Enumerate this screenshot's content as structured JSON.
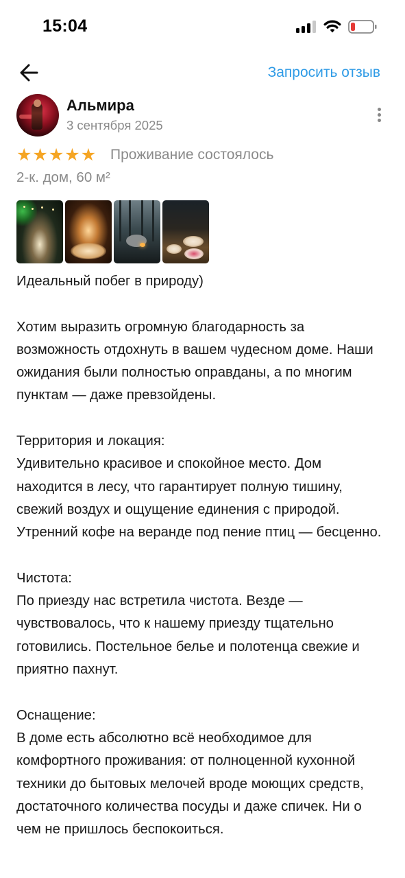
{
  "status_bar": {
    "time": "15:04",
    "icons": [
      "signal-icon",
      "wifi-icon",
      "battery-low-icon"
    ],
    "battery_color": "#e53935"
  },
  "topbar": {
    "back_icon": "arrow-left-icon",
    "request_review_label": "Запросить отзыв",
    "accent_color": "#2f9be6"
  },
  "review_header": {
    "author": "Альмира",
    "date": "3 сентября 2025",
    "more_icon": "more-vertical-icon"
  },
  "rating": {
    "stars": 5,
    "max": 5,
    "star_color": "#f5a524",
    "status": "Проживание состоялось"
  },
  "property": "2-к. дом, 60 м²",
  "photos": [
    {
      "name": "photo-1",
      "count": 1
    },
    {
      "name": "photo-2",
      "count": 1
    },
    {
      "name": "photo-3",
      "count": 1
    },
    {
      "name": "photo-4",
      "count": 1
    }
  ],
  "review": {
    "title": "Идеальный побег в природу)",
    "paragraphs": [
      "Хотим выразить огромную благодарность за возможность отдохнуть в вашем чудесном доме. Наши ожидания были полностью оправданы, а по многим пунктам — даже превзойдены.",
      "Территория и локация:\nУдивительно красивое и спокойное место. Дом находится в лесу, что гарантирует полную тишину, свежий воздух и ощущение единения с природой. Утренний кофе на веранде под пение птиц — бесценно.",
      "Чистота:\nПо приезду нас встретила чистота. Везде  — чувствовалось, что к нашему приезду тщательно готовились. Постельное белье и полотенца свежие и приятно пахнут.",
      "Оснащение:\nВ доме есть абсолютно всё необходимое для комфортного проживания: от полноценной кухонной техники до бытовых мелочей вроде моющих средств, достаточного количества посуды и даже спичек. Ни о чем не пришлось беспокоиться."
    ]
  }
}
